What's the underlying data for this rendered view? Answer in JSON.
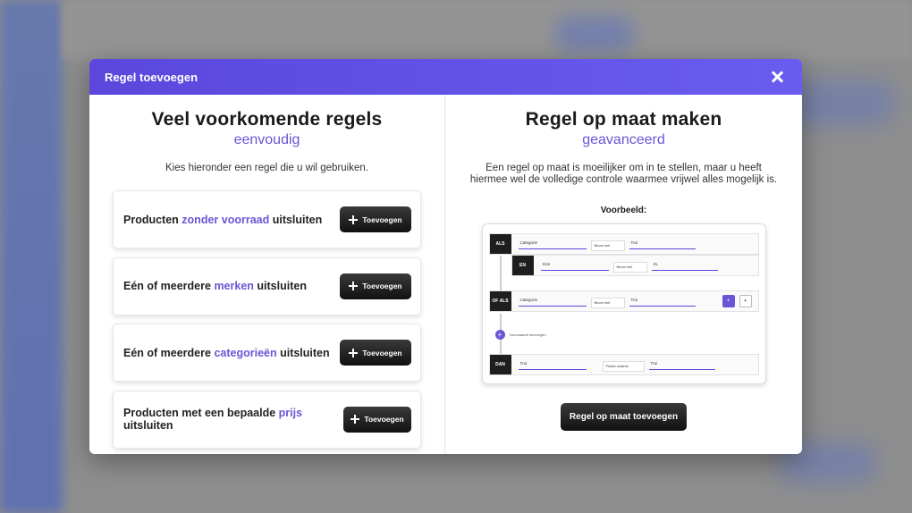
{
  "modal": {
    "title": "Regel toevoegen"
  },
  "left": {
    "heading": "Veel voorkomende regels",
    "subheading": "eenvoudig",
    "description": "Kies hieronder een regel die u wil gebruiken.",
    "button_label": "Toevoegen",
    "rules": [
      {
        "pre": "Producten ",
        "hl": "zonder voorraad",
        "post": " uitsluiten"
      },
      {
        "pre": "Eén of meerdere ",
        "hl": "merken",
        "post": " uitsluiten"
      },
      {
        "pre": "Eén of meerdere ",
        "hl": "categorieën",
        "post": " uitsluiten"
      },
      {
        "pre": "Producten met een bepaalde ",
        "hl": "prijs",
        "post": " uitsluiten"
      }
    ]
  },
  "right": {
    "heading": "Regel op maat maken",
    "subheading": "geavanceerd",
    "description_line1": "Een regel op maat is moeilijker om in te stellen, maar u heeft",
    "description_line2": "hiermee wel de volledige controle waarmee vrijwel alles mogelijk is.",
    "example_label": "Voorbeeld:",
    "button_label": "Regel op maat toevoegen",
    "example": {
      "row1": {
        "tag": "ALS",
        "field": "Categorie",
        "op": "Bevat niet",
        "value": "Trui"
      },
      "row2": {
        "tag": "EN",
        "field": "Size",
        "op": "Bevat niet",
        "value": "XL"
      },
      "row3": {
        "tag": "OF ALS",
        "field": "Categorie",
        "op": "Bevat niet",
        "value": "Trui"
      },
      "add_condition": "Voorwaarde toevoegen",
      "row4": {
        "tag": "DAN",
        "field": "Trui",
        "op": "Plaats waarde",
        "value": "Trui"
      }
    }
  }
}
